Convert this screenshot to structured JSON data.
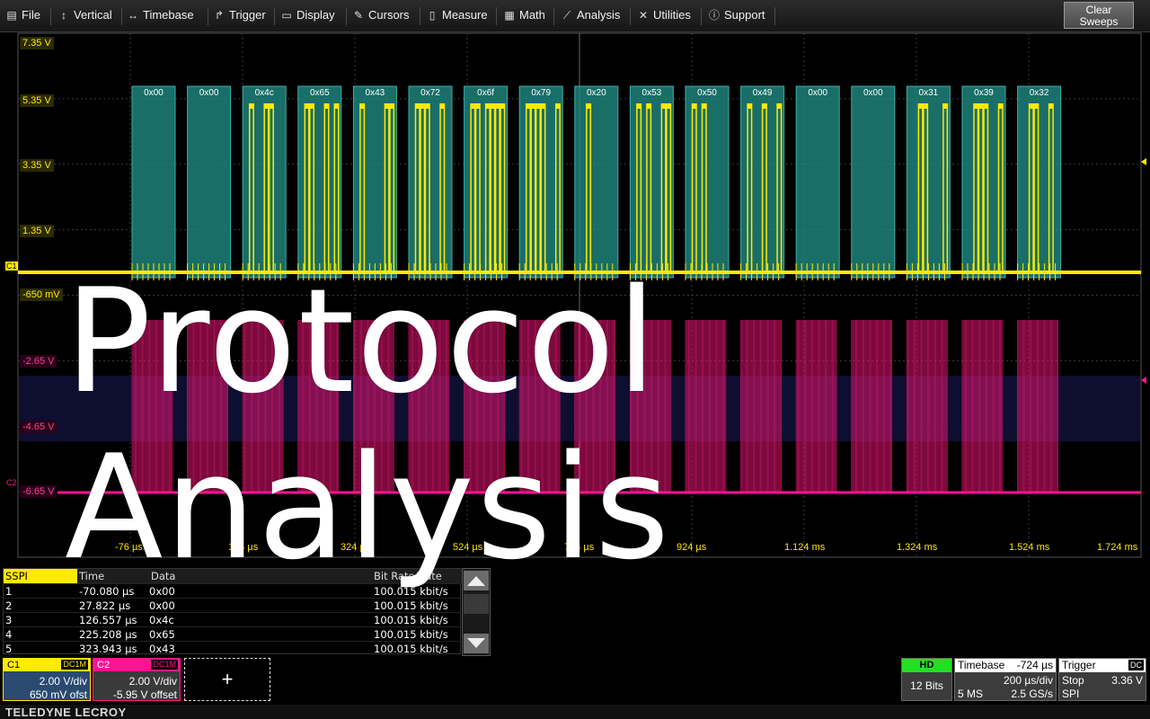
{
  "menubar": {
    "items": [
      {
        "label": "File",
        "icon": "file-icon"
      },
      {
        "label": "Vertical",
        "icon": "vertical-arrows-icon"
      },
      {
        "label": "Timebase",
        "icon": "horizontal-arrows-icon"
      },
      {
        "label": "Trigger",
        "icon": "trigger-icon"
      },
      {
        "label": "Display",
        "icon": "display-icon"
      },
      {
        "label": "Cursors",
        "icon": "cursors-icon"
      },
      {
        "label": "Measure",
        "icon": "measure-icon"
      },
      {
        "label": "Math",
        "icon": "math-icon"
      },
      {
        "label": "Analysis",
        "icon": "analysis-icon"
      },
      {
        "label": "Utilities",
        "icon": "utilities-icon"
      },
      {
        "label": "Support",
        "icon": "support-icon"
      }
    ],
    "clear_sweeps": "Clear\nSweeps"
  },
  "grid": {
    "c1_labels": [
      "7.35 V",
      "5.35 V",
      "3.35 V",
      "1.35 V",
      "-650 mV"
    ],
    "c2_labels": [
      "-2.65 V",
      "-4.65 V",
      "-6.65 V"
    ],
    "x_labels": [
      "-76 µs",
      "124 µs",
      "324 µs",
      "524 µs",
      "724 µs",
      "924 µs",
      "1.124 ms",
      "1.324 ms",
      "1.524 ms",
      "1.724 ms"
    ],
    "c1_marker": "C1",
    "c2_marker": "C2"
  },
  "decode": {
    "bytes": [
      "0x00",
      "0x00",
      "0x4c",
      "0x65",
      "0x43",
      "0x72",
      "0x6f",
      "0x79",
      "0x20",
      "0x53",
      "0x50",
      "0x49",
      "0x00",
      "0x00",
      "0x31",
      "0x39",
      "0x32"
    ]
  },
  "overlay": {
    "line1": "Protocol",
    "line2": "Analysis"
  },
  "table": {
    "title": "SSPI",
    "headers": [
      "Time",
      "Data",
      "Bit Rate/Rate"
    ],
    "rows": [
      {
        "idx": "1",
        "time": "-70.080 µs",
        "data": "0x00",
        "rate": "100.015 kbit/s"
      },
      {
        "idx": "2",
        "time": "27.822 µs",
        "data": "0x00",
        "rate": "100.015 kbit/s"
      },
      {
        "idx": "3",
        "time": "126.557 µs",
        "data": "0x4c",
        "rate": "100.015 kbit/s"
      },
      {
        "idx": "4",
        "time": "225.208 µs",
        "data": "0x65",
        "rate": "100.015 kbit/s"
      },
      {
        "idx": "5",
        "time": "323.943 µs",
        "data": "0x43",
        "rate": "100.015 kbit/s"
      }
    ]
  },
  "channels": {
    "c1": {
      "name": "C1",
      "coupling": "DC1M",
      "vdiv": "2.00 V/div",
      "offset": "650 mV ofst",
      "color": "#ffea00"
    },
    "c2": {
      "name": "C2",
      "coupling": "DC1M",
      "vdiv": "2.00 V/div",
      "offset": "-5.95 V offset",
      "color": "#ff1493"
    },
    "add_label": "+"
  },
  "status": {
    "hd_label": "HD",
    "bits": "12 Bits",
    "timebase_label": "Timebase",
    "timebase_delay": "-724 µs",
    "timebase_div": "200 µs/div",
    "timebase_samples": "5 MS",
    "timebase_rate": "2.5 GS/s",
    "trigger_label": "Trigger",
    "trigger_coupling": "DC",
    "trigger_mode": "Stop",
    "trigger_level": "3.36 V",
    "trigger_type": "SPI"
  },
  "brand": "TELEDYNE LECROY"
}
